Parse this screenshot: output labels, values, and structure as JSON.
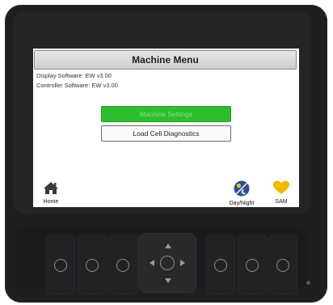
{
  "screen": {
    "title": "Machine Menu",
    "display_software": "Display Software: EW v3.00",
    "controller_software": "Controller Software: EW v3.00",
    "buttons": {
      "machine_settings": "Machine Settings",
      "load_cell_diagnostics": "Load Cell Diagnostics"
    },
    "bottom": {
      "home": "Home",
      "day_night": "Day/Night",
      "sam": "SAM"
    }
  },
  "icons": {
    "home": "home-icon",
    "day_night": "day-night-icon",
    "sam": "heart-icon"
  },
  "colors": {
    "accent_green": "#2ebd2e",
    "sam_heart": "#f5b800",
    "day_night": "#2c4f8f"
  }
}
